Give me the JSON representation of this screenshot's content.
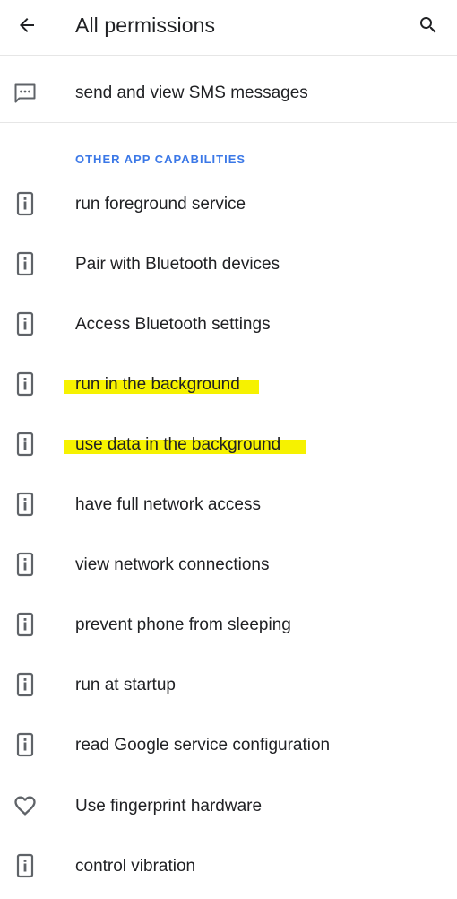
{
  "header": {
    "title": "All permissions",
    "back_icon": "arrow-back-icon",
    "search_icon": "search-icon"
  },
  "sms_permission": {
    "label": "send and view SMS messages",
    "icon": "message-icon"
  },
  "section": {
    "title": "OTHER APP CAPABILITIES"
  },
  "permissions": [
    {
      "label": "run foreground service",
      "icon": "info-icon"
    },
    {
      "label": "Pair with Bluetooth devices",
      "icon": "info-icon"
    },
    {
      "label": "Access Bluetooth settings",
      "icon": "info-icon"
    },
    {
      "label": "run in the background",
      "icon": "info-icon",
      "highlighted": true
    },
    {
      "label": "use data in the background",
      "icon": "info-icon",
      "highlighted": true
    },
    {
      "label": "have full network access",
      "icon": "info-icon"
    },
    {
      "label": "view network connections",
      "icon": "info-icon"
    },
    {
      "label": "prevent phone from sleeping",
      "icon": "info-icon"
    },
    {
      "label": "run at startup",
      "icon": "info-icon"
    },
    {
      "label": "read Google service configuration",
      "icon": "info-icon"
    },
    {
      "label": "Use fingerprint hardware",
      "icon": "heart-icon"
    },
    {
      "label": "control vibration",
      "icon": "info-icon"
    }
  ],
  "colors": {
    "accent": "#3b78e7",
    "highlight": "#f6f200",
    "text": "#202124",
    "icon": "#5f6368"
  }
}
